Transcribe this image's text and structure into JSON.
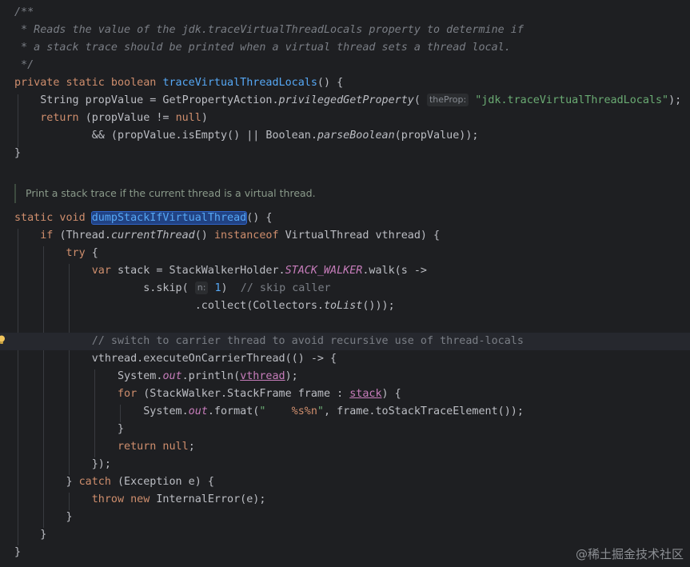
{
  "editor": {
    "doc_comment": [
      "/**",
      " * Reads the value of the jdk.traceVirtualThreadLocals property to determine if",
      " * a stack trace should be printed when a virtual thread sets a thread local.",
      " */"
    ],
    "rendered_doc": "Print a stack trace if the current thread is a virtual thread.",
    "hints": {
      "theProp": "theProp:",
      "n": "n:"
    }
  },
  "watermark": "@稀土掘金技术社区",
  "colors": {
    "background": "#1e1f22",
    "keyword": "#cf8e6d",
    "function": "#56a8f5",
    "string": "#6aab73",
    "comment": "#7a7e85",
    "static_field": "#c77dbb"
  }
}
